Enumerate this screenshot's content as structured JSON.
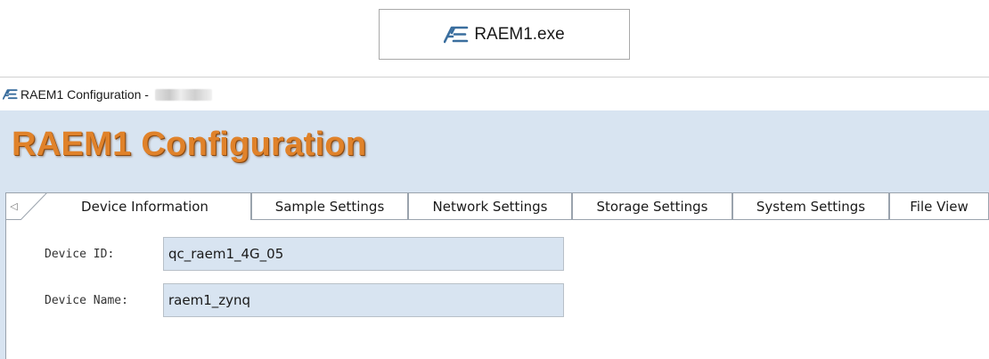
{
  "callout": {
    "exe_name": "RAEM1.exe",
    "icon": "ae-logo-icon"
  },
  "window": {
    "title": "RAEM1 Configuration - ",
    "title_suffix_redacted": true,
    "icon": "ae-logo-icon"
  },
  "app": {
    "heading": "RAEM1 Configuration",
    "heading_color": "#e0822a",
    "background_color": "#d8e4f1"
  },
  "tabs": [
    {
      "label": "Device Information",
      "active": true
    },
    {
      "label": "Sample Settings",
      "active": false
    },
    {
      "label": "Network Settings",
      "active": false
    },
    {
      "label": "Storage Settings",
      "active": false
    },
    {
      "label": "System Settings",
      "active": false
    },
    {
      "label": "File View",
      "active": false
    }
  ],
  "tab_scroll_icon": "chevron-left-icon",
  "form": {
    "device_id": {
      "label": "Device ID:",
      "value": "qc_raem1_4G_05"
    },
    "device_name": {
      "label": "Device Name:",
      "value": "raem1_zynq"
    }
  }
}
